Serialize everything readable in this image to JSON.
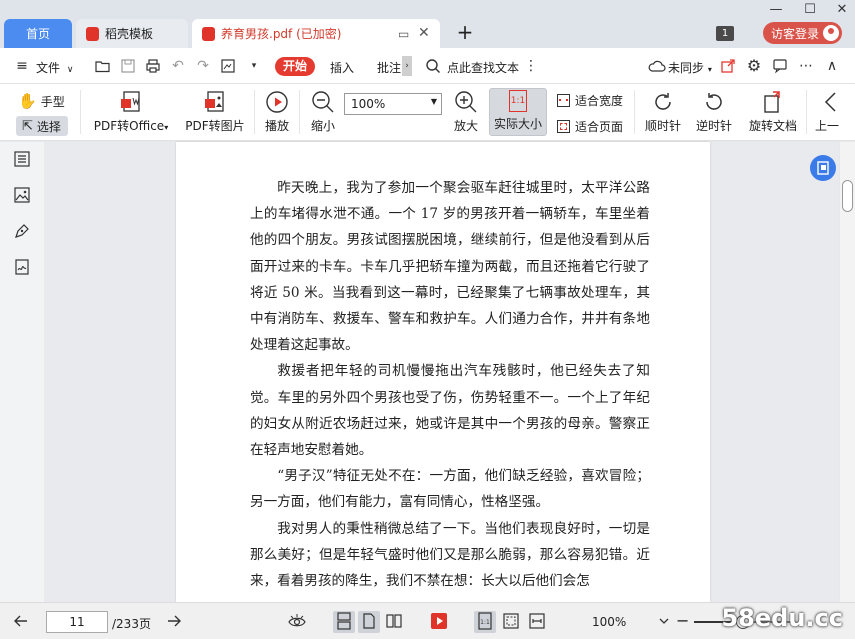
{
  "titlebar": {
    "tabs": [
      {
        "label": "首页"
      },
      {
        "label": "稻壳模板"
      },
      {
        "label": "养育男孩.pdf (已加密)"
      }
    ],
    "badge_number": "1",
    "login_label": "访客登录"
  },
  "menubar": {
    "file_label": "文件",
    "start_label": "开始",
    "insert_label": "插入",
    "annotate_label": "批注",
    "search_label": "点此查找文本",
    "sync_label": "未同步"
  },
  "ribbon": {
    "hand_label": "手型",
    "select_label": "选择",
    "pdf_to_office_label": "PDF转Office",
    "pdf_to_image_label": "PDF转图片",
    "play_label": "播放",
    "zoom_out_label": "缩小",
    "zoom_value": "100%",
    "zoom_in_label": "放大",
    "actual_size_label": "实际大小",
    "actual_size_icon_text": "1:1",
    "fit_width_label": "适合宽度",
    "fit_page_label": "适合页面",
    "clockwise_label": "顺时针",
    "counterclockwise_label": "逆时针",
    "rotate_doc_label": "旋转文档",
    "prev_label": "上一"
  },
  "document": {
    "paragraphs": [
      "昨天晚上，我为了参加一个聚会驱车赶往城里时，太平洋公路上的车堵得水泄不通。一个 17 岁的男孩开着一辆轿车，车里坐着他的四个朋友。男孩试图摆脱困境，继续前行，但是他没看到从后面开过来的卡车。卡车几乎把轿车撞为两截，而且还拖着它行驶了将近 50 米。当我看到这一幕时，已经聚集了七辆事故处理车，其中有消防车、救援车、警车和救护车。人们通力合作，井井有条地处理着这起事故。",
      "救援者把年轻的司机慢慢拖出汽车残骸时，他已经失去了知觉。车里的另外四个男孩也受了伤，伤势轻重不一。一个上了年纪的妇女从附近农场赶过来，她或许是其中一个男孩的母亲。警察正在轻声地安慰着她。",
      "“男子汉”特征无处不在：一方面，他们缺乏经验，喜欢冒险；另一方面，他们有能力，富有同情心，性格坚强。",
      "我对男人的秉性稍微总结了一下。当他们表现良好时，一切是那么美好；但是年轻气盛时他们又是那么脆弱，那么容易犯错。近来，看着男孩的降生，我们不禁在想：长大以后他们会怎"
    ]
  },
  "statusbar": {
    "current_page": "11",
    "total_pages": "/233页",
    "zoom_value": "100%",
    "zoom_fraction": 0.5
  },
  "watermark": "58edu.cc",
  "colors": {
    "accent_blue": "#4c8bf0",
    "accent_red": "#e53a2f",
    "login_red": "#d9534a"
  }
}
